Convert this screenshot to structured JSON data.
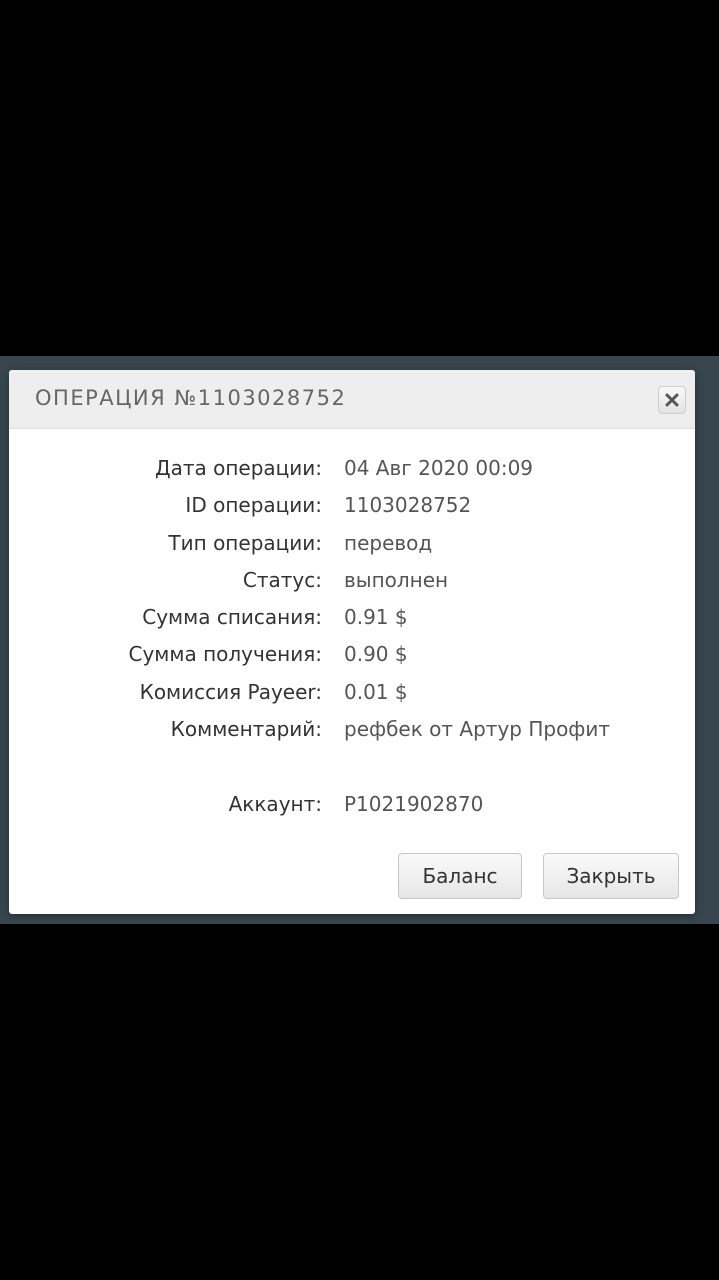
{
  "dialog": {
    "title": "ОПЕРАЦИЯ №1103028752",
    "close_icon": "close-icon"
  },
  "details": [
    {
      "label": "Дата операции:",
      "value": "04 Авг 2020 00:09"
    },
    {
      "label": "ID операции:",
      "value": "1103028752"
    },
    {
      "label": "Тип операции:",
      "value": "перевод"
    },
    {
      "label": "Статус:",
      "value": "выполнен"
    },
    {
      "label": "Сумма списания:",
      "value": "0.91 $"
    },
    {
      "label": "Сумма получения:",
      "value": "0.90 $"
    },
    {
      "label": "Комиссия Payeer:",
      "value": "0.01 $"
    },
    {
      "label": "Комментарий:",
      "value": "рефбек от Артур Профит"
    }
  ],
  "account": {
    "label": "Аккаунт:",
    "value": "P1021902870"
  },
  "buttons": {
    "balance": "Баланс",
    "close": "Закрыть"
  },
  "colors": {
    "backdrop": "#37464e",
    "header_bg": "#eeeeee",
    "title_text": "#666666"
  }
}
